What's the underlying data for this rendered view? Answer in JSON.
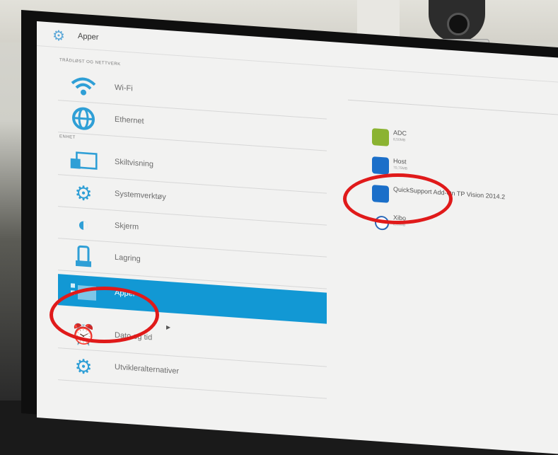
{
  "header": {
    "title": "Apper",
    "icon": "gear-icon"
  },
  "sections": {
    "wireless": "TRÅDLØST OG NETTVERK",
    "device": "ENHET"
  },
  "menu": [
    {
      "label": "Wi-Fi",
      "icon": "wifi-icon"
    },
    {
      "label": "Ethernet",
      "icon": "globe-icon"
    },
    {
      "label": "Skiltvisning",
      "icon": "display-icon"
    },
    {
      "label": "Systemverktøy",
      "icon": "gear-icon"
    },
    {
      "label": "Skjerm",
      "icon": "contrast-icon"
    },
    {
      "label": "Lagring",
      "icon": "storage-icon"
    },
    {
      "label": "Apper",
      "icon": "apps-icon",
      "active": true
    },
    {
      "label": "Dato og tid",
      "icon": "clock-icon"
    },
    {
      "label": "Utvikleralternativer",
      "icon": "developer-options-icon"
    }
  ],
  "apps": [
    {
      "name": "ADC",
      "size": "8,50MB",
      "icon": "adc-app-icon"
    },
    {
      "name": "Host",
      "size": "70,75MB",
      "icon": "teamviewer-host-icon"
    },
    {
      "name": "QuickSupport Add-On TP Vision 2014.2",
      "size": "",
      "icon": "teamviewer-quicksupport-icon"
    },
    {
      "name": "Xibo",
      "size": "8,69MB",
      "icon": "xibo-app-icon"
    }
  ],
  "colors": {
    "accent": "#1298d4",
    "highlight_annotation": "#e01a1a"
  }
}
